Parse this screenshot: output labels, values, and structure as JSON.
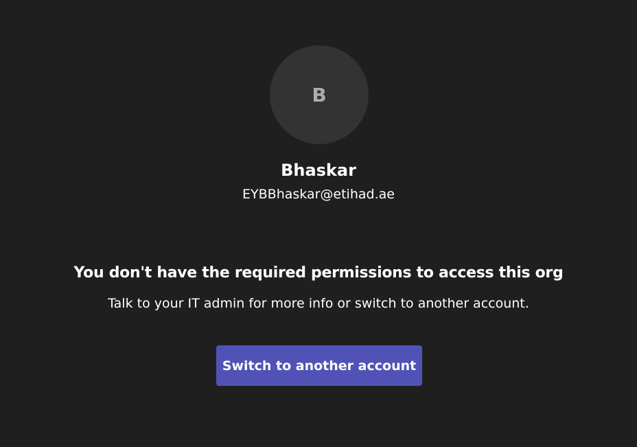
{
  "account": {
    "initial": "B",
    "name": "Bhaskar",
    "email": "EYBBhaskar@etihad.ae"
  },
  "message": {
    "title": "You don't have the required permissions to access this org",
    "body": "Talk to your IT admin for more info or switch to another account."
  },
  "actions": {
    "switch_account_label": "Switch to another account"
  },
  "colors": {
    "background": "#1f1f1f",
    "avatar_background": "#333333",
    "avatar_initial": "#adadad",
    "primary_button": "#5053b5",
    "text": "#ffffff"
  }
}
